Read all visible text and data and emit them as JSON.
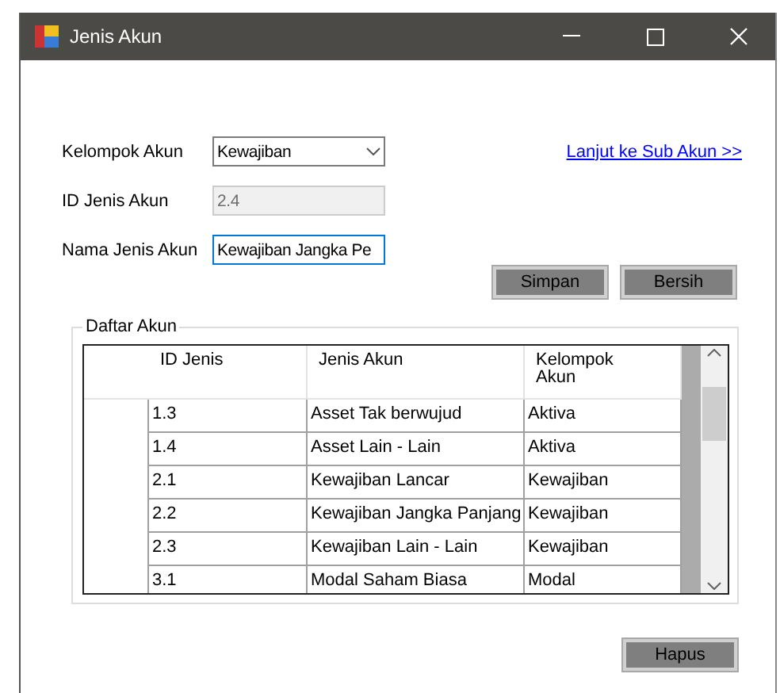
{
  "window": {
    "title": "Jenis Akun"
  },
  "form": {
    "kelompok": {
      "label": "Kelompok Akun",
      "value": "Kewajiban"
    },
    "id": {
      "label": "ID Jenis Akun",
      "value": "2.4",
      "disabled": true
    },
    "nama": {
      "label": "Nama Jenis Akun",
      "value": "Kewajiban Jangka Pe",
      "focused": true
    },
    "link": "Lanjut ke Sub Akun >>"
  },
  "buttons": [
    "Simpan",
    "Bersih"
  ],
  "group": {
    "title": "Daftar Akun",
    "columns": [
      "ID Jenis",
      "Jenis Akun",
      "Kelompok Akun"
    ],
    "rows": [
      [
        "1.3",
        "Asset Tak berwujud",
        "Aktiva"
      ],
      [
        "1.4",
        "Asset Lain - Lain",
        "Aktiva"
      ],
      [
        "2.1",
        "Kewajiban Lancar",
        "Kewajiban"
      ],
      [
        "2.2",
        "Kewajiban Jangka Panjang",
        "Kewajiban"
      ],
      [
        "2.3",
        "Kewajiban Lain - Lain",
        "Kewajiban"
      ],
      [
        "3.1",
        "Modal Saham Biasa",
        "Modal"
      ]
    ]
  },
  "delete_button": "Hapus"
}
